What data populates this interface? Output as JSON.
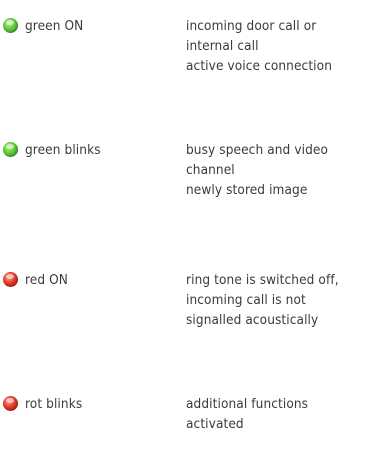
{
  "entries": [
    {
      "indicator": "green-led-icon",
      "color": "#4cbe2e",
      "label": "green ON",
      "description_lines": [
        "incoming door call or",
        "internal call",
        "active voice connection"
      ]
    },
    {
      "indicator": "green-led-icon",
      "color": "#4cbe2e",
      "label": "green blinks",
      "description_lines": [
        "busy speech and video",
        "channel",
        "newly stored image"
      ]
    },
    {
      "indicator": "red-led-icon",
      "color": "#d9322a",
      "label": "red ON",
      "description_lines": [
        "ring tone is switched off,",
        "incoming call is not",
        "signalled acoustically"
      ]
    },
    {
      "indicator": "red-led-icon",
      "color": "#d9322a",
      "label": "rot blinks",
      "description_lines": [
        "additional functions",
        "activated"
      ]
    }
  ]
}
